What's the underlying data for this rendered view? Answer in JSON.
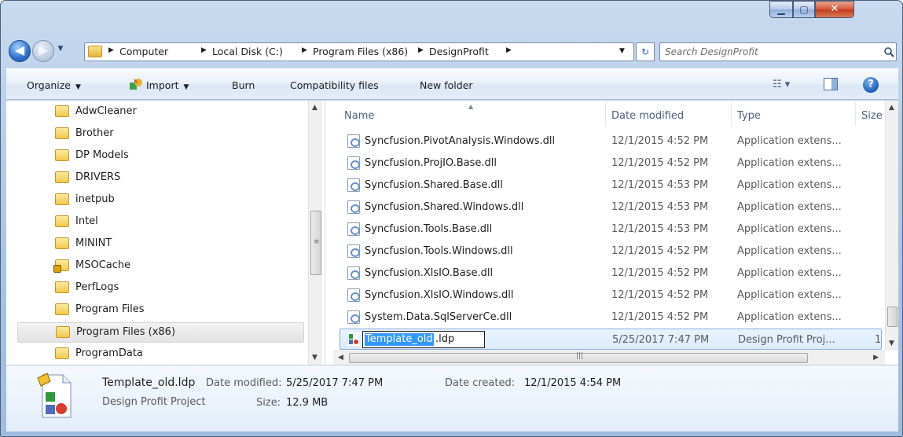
{
  "breadcrumb": [
    "Computer",
    "Local Disk (C:)",
    "Program Files (x86)",
    "DesignProfit"
  ],
  "search": {
    "placeholder": "Search DesignProfit"
  },
  "toolbar": {
    "organize": "Organize",
    "import": "Import",
    "burn": "Burn",
    "compatibility": "Compatibility files",
    "new_folder": "New folder"
  },
  "nav_items": [
    {
      "label": "AdwCleaner"
    },
    {
      "label": "Brother"
    },
    {
      "label": "DP Models"
    },
    {
      "label": "DRIVERS"
    },
    {
      "label": "inetpub"
    },
    {
      "label": "Intel"
    },
    {
      "label": "MININT"
    },
    {
      "label": "MSOCache"
    },
    {
      "label": "PerfLogs"
    },
    {
      "label": "Program Files"
    },
    {
      "label": "Program Files (x86)",
      "selected": true
    },
    {
      "label": "ProgramData"
    }
  ],
  "columns": {
    "name": "Name",
    "date": "Date modified",
    "type": "Type",
    "size": "Size"
  },
  "files": [
    {
      "name": "Syncfusion.PivotAnalysis.Windows.dll",
      "date": "12/1/2015 4:52 PM",
      "type": "Application extens..."
    },
    {
      "name": "Syncfusion.ProjIO.Base.dll",
      "date": "12/1/2015 4:52 PM",
      "type": "Application extens..."
    },
    {
      "name": "Syncfusion.Shared.Base.dll",
      "date": "12/1/2015 4:53 PM",
      "type": "Application extens..."
    },
    {
      "name": "Syncfusion.Shared.Windows.dll",
      "date": "12/1/2015 4:53 PM",
      "type": "Application extens..."
    },
    {
      "name": "Syncfusion.Tools.Base.dll",
      "date": "12/1/2015 4:53 PM",
      "type": "Application extens..."
    },
    {
      "name": "Syncfusion.Tools.Windows.dll",
      "date": "12/1/2015 4:52 PM",
      "type": "Application extens..."
    },
    {
      "name": "Syncfusion.XlsIO.Base.dll",
      "date": "12/1/2015 4:52 PM",
      "type": "Application extens..."
    },
    {
      "name": "Syncfusion.XlsIO.Windows.dll",
      "date": "12/1/2015 4:52 PM",
      "type": "Application extens..."
    },
    {
      "name": "System.Data.SqlServerCe.dll",
      "date": "12/1/2015 4:52 PM",
      "type": "Application extens..."
    }
  ],
  "renaming_file": {
    "selected_part": "Template_old",
    "extension": ".ldp",
    "date": "5/25/2017 7:47 PM",
    "type": "Design Profit Proj...",
    "size": "1"
  },
  "details": {
    "filename": "Template_old.ldp",
    "filetype": "Design Profit Project",
    "date_modified_label": "Date modified:",
    "date_modified": "5/25/2017 7:47 PM",
    "date_created_label": "Date created:",
    "date_created": "12/1/2015 4:54 PM",
    "size_label": "Size:",
    "size": "12.9 MB"
  },
  "icons": {
    "back": "back-arrow-icon",
    "forward": "forward-arrow-icon",
    "refresh": "refresh-icon",
    "search": "search-icon",
    "help": "help-icon"
  }
}
